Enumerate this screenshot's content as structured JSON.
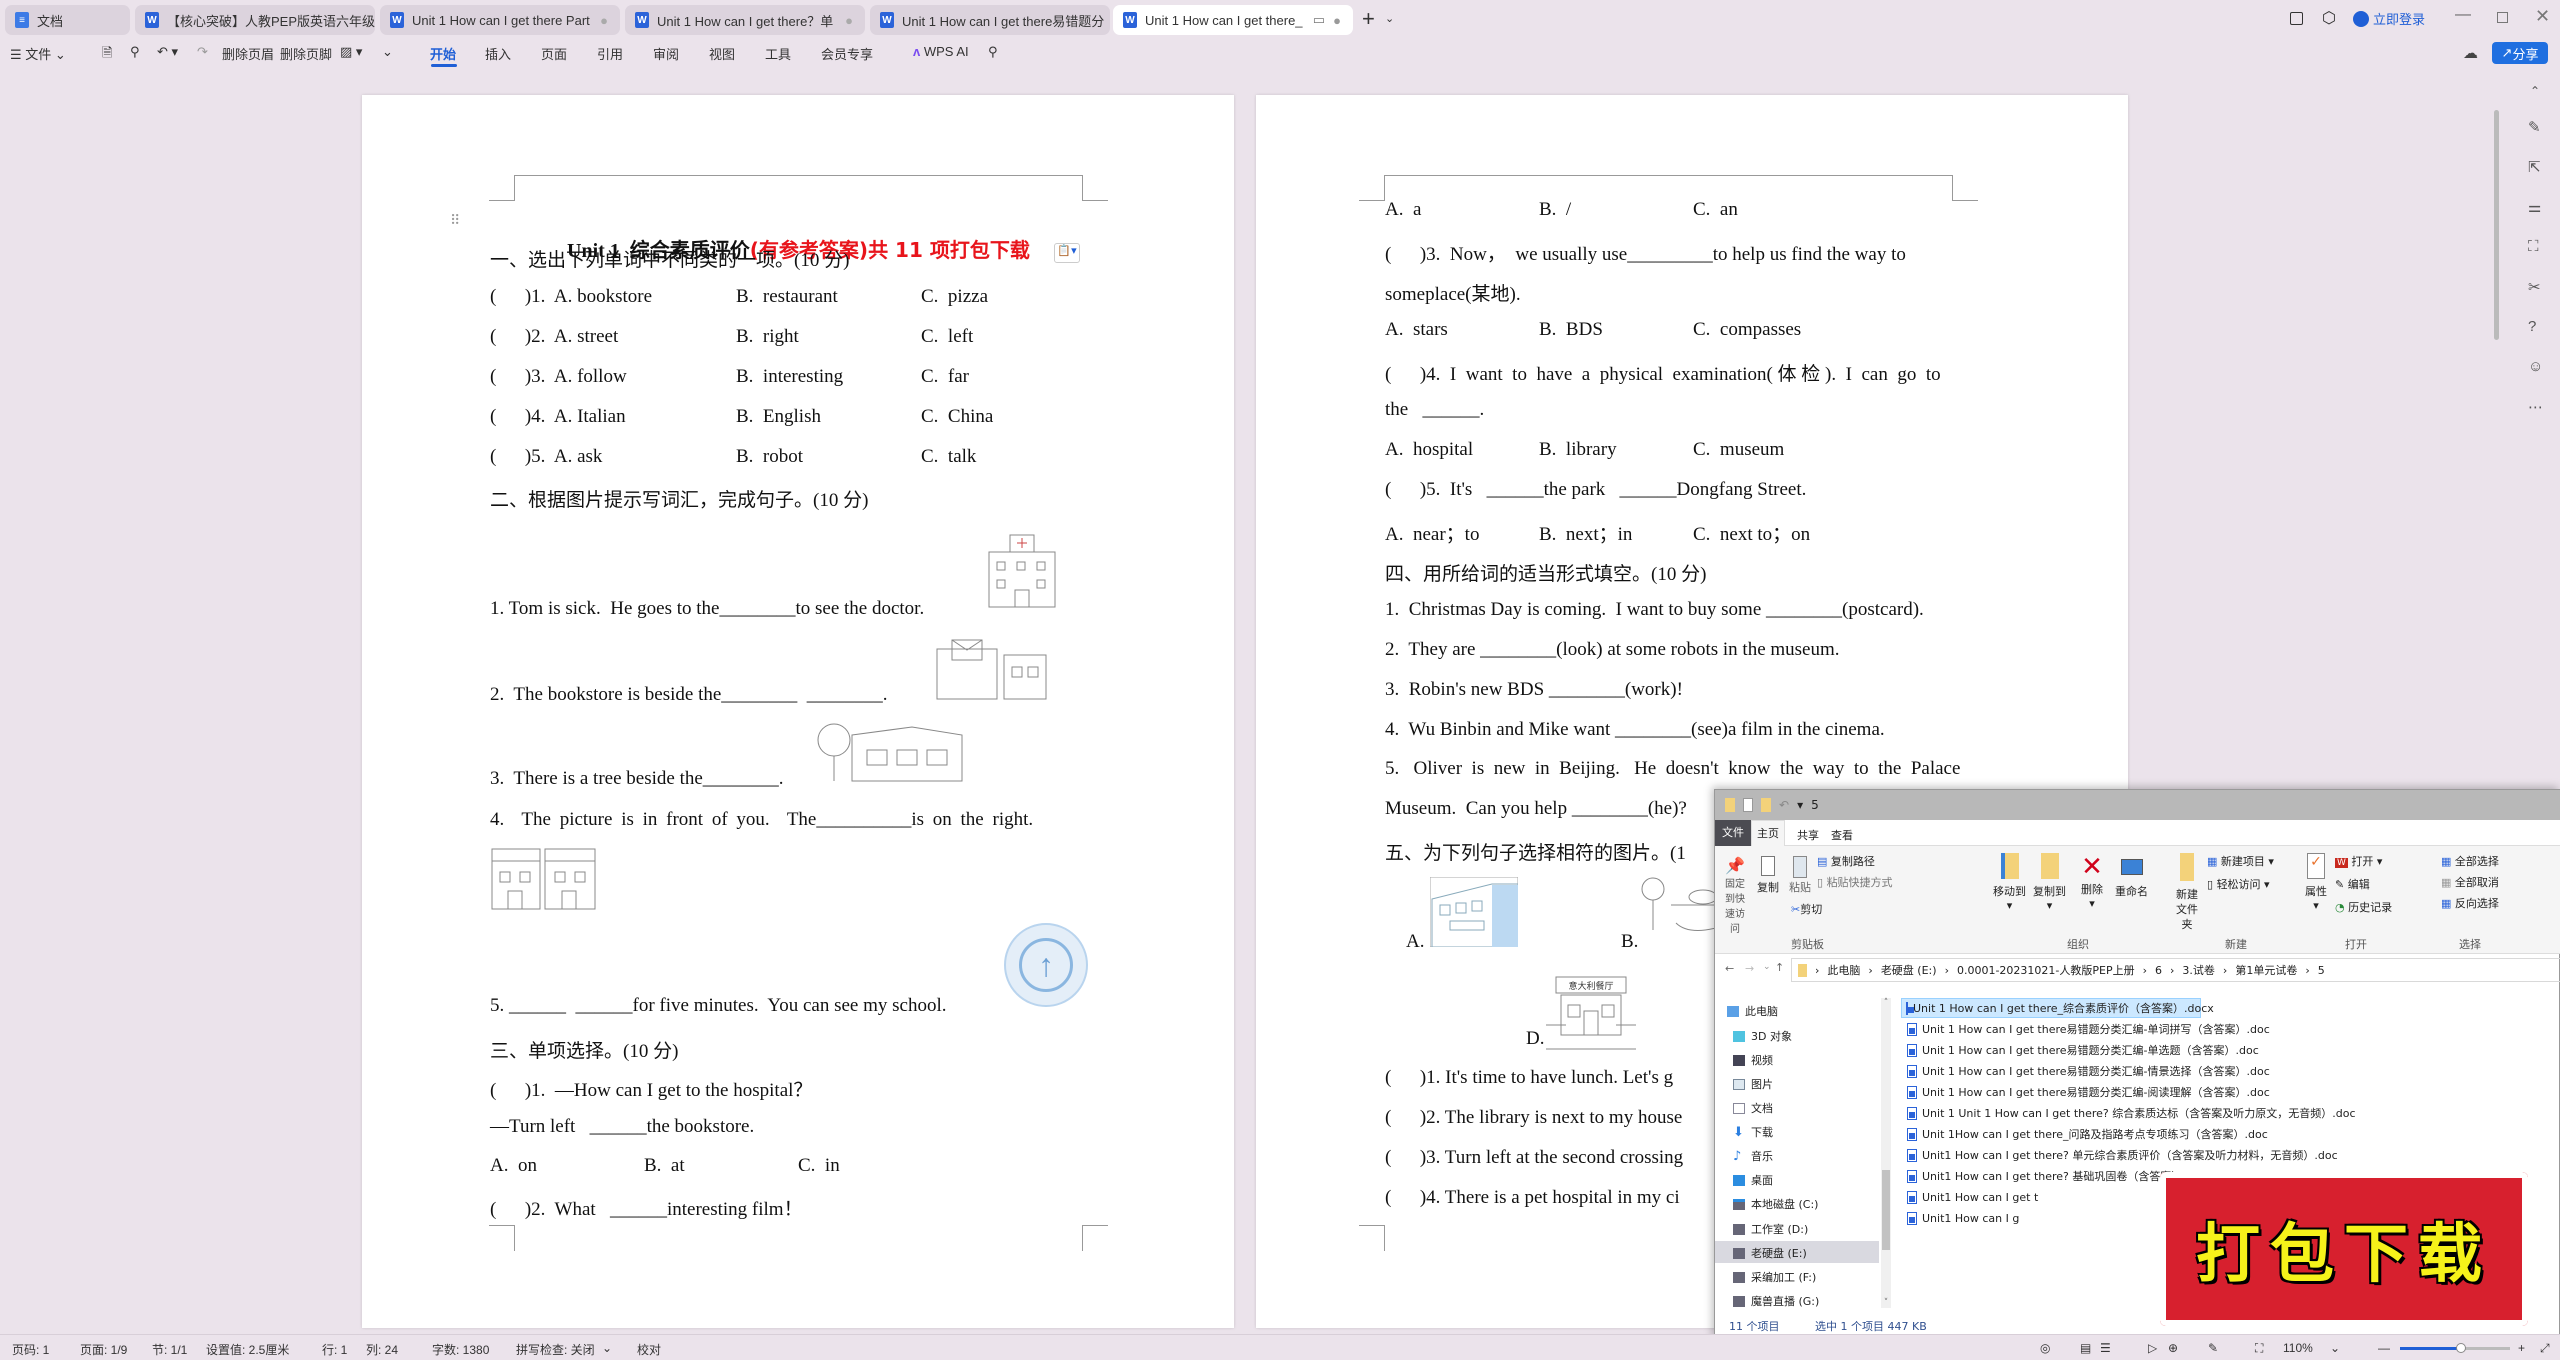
{
  "tabs": [
    {
      "label": "文档"
    },
    {
      "label": "【核心突破】人教PEP版英语六年级上"
    },
    {
      "label": "Unit 1 How can I get there Part"
    },
    {
      "label": "Unit 1 How can I get there？单"
    },
    {
      "label": "Unit 1 How can I get there易错题分"
    },
    {
      "label": "Unit 1 How can I get there_"
    }
  ],
  "titlebar": {
    "login": "立即登录",
    "share": "分享"
  },
  "toolbar": {
    "file": "文件",
    "delete_header": "删除页眉",
    "delete_footer": "删除页脚",
    "menus": [
      "开始",
      "插入",
      "页面",
      "引用",
      "审阅",
      "视图",
      "工具",
      "会员专享"
    ],
    "wps_ai": "WPS AI"
  },
  "left_page": {
    "title_black": "Unit 1  综合素质评价",
    "title_red": "(有参考答案)共 11 项打包下载",
    "section1": "一、选出下列单词中不同类的一项。(10 分)",
    "s1_rows": [
      {
        "q": "(      )1.  A. bookstore",
        "b": "B.  restaurant",
        "c": "C.  pizza"
      },
      {
        "q": "(      )2.  A. street",
        "b": "B.  right",
        "c": "C.  left"
      },
      {
        "q": "(      )3.  A. follow",
        "b": "B.  interesting",
        "c": "C.  far"
      },
      {
        "q": "(      )4.  A. Italian",
        "b": "B.  English",
        "c": "C.  China"
      },
      {
        "q": "(      )5.  A. ask",
        "b": "B.  robot",
        "c": "C.  talk"
      }
    ],
    "section2": "二、根据图片提示写词汇，完成句子。(10 分)",
    "s2": [
      "1. Tom is sick.  He goes to the________to see the doctor.",
      "2.  The bookstore is beside the________  ________.",
      "3.  There is a tree beside the________.",
      "4.  The picture is in front of you.  The__________is on the right.",
      "5. ______  ______for five minutes.  You can see my school."
    ],
    "section3": "三、单项选择。(10 分)",
    "s3": [
      "(      )1.  —How can I get to the hospital？",
      "—Turn left   ______the bookstore.",
      "(      )2.  What   ______interesting film！"
    ],
    "s3_options": {
      "a": "A.  on",
      "b": "B.  at",
      "c": "C.  in"
    }
  },
  "right_page": {
    "opts1": {
      "a": "A.  a",
      "b": "B.  /",
      "c": "C.  an"
    },
    "q3_l1": "(      )3.  Now，  we usually use_________to help us find the way to",
    "q3_l2": "someplace(某地).",
    "opts3": {
      "a": "A.  stars",
      "b": "B.  BDS",
      "c": "C.  compasses"
    },
    "q4_l1": "(      )4.  I  want  to  have  a  physical  examination( 体 检 ).  I  can  go  to",
    "q4_l2": "the   ______.",
    "opts4": {
      "a": "A.  hospital",
      "b": "B.  library",
      "c": "C.  museum"
    },
    "q5": "(      )5.  It's   ______the park   ______Dongfang Street.",
    "opts5": {
      "a": "A.  near；to",
      "b": "B.  next；in",
      "c": "C.  next to；on"
    },
    "section4": "四、用所给词的适当形式填空。(10 分)",
    "s4": [
      "1.  Christmas Day is coming.  I want to buy some ________(postcard).",
      "2.  They are ________(look) at some robots in the museum.",
      "3.  Robin's new BDS ________(work)!",
      "4.  Wu Binbin and Mike want ________(see)a film in the cinema.",
      "5.   Oliver  is  new  in  Beijing.   He  doesn't  know  the  way  to  the  Palace",
      "Museum.  Can you help ________(he)?"
    ],
    "section5": "五、为下列句子选择相符的图片。(1",
    "pic_labels": [
      "A.",
      "B.",
      "D."
    ],
    "pic_sign_d": "意大利餐厅",
    "s5": [
      "(      )1. It's time to have lunch. Let's g",
      "(      )2. The library is next to my house",
      "(      )3. Turn left at the second crossing",
      "(      )4. There is a pet hospital in my ci"
    ]
  },
  "explorer": {
    "title": "5",
    "ribbon_tabs": [
      "文件",
      "主页",
      "共享",
      "查看"
    ],
    "clipboard": {
      "pin": "固定到快速访问",
      "copy": "复制",
      "paste": "粘贴",
      "copy_path": "复制路径",
      "paste_shortcut": "粘贴快捷方式",
      "cut": "剪切",
      "label": "剪贴板"
    },
    "organize": {
      "move_to": "移动到",
      "copy_to": "复制到",
      "delete": "删除",
      "rename": "重命名",
      "label": "组织"
    },
    "new": {
      "new_folder": "新建文件夹",
      "new_item": "新建项目",
      "easy_access": "轻松访问",
      "label": "新建"
    },
    "open": {
      "properties": "属性",
      "open": "打开",
      "edit": "编辑",
      "history": "历史记录",
      "label": "打开"
    },
    "select": {
      "select_all": "全部选择",
      "select_none": "全部取消",
      "invert": "反向选择",
      "label": "选择"
    },
    "path": [
      "此电脑",
      "老硬盘 (E:)",
      "0.0001-20231021-人教版PEP上册",
      "6",
      "3.试卷",
      "第1单元试卷",
      "5"
    ],
    "nav": [
      "此电脑",
      "3D 对象",
      "视频",
      "图片",
      "文档",
      "下载",
      "音乐",
      "桌面",
      "本地磁盘 (C:)",
      "工作室 (D:)",
      "老硬盘 (E:)",
      "采编加工 (F:)",
      "魔兽直播 (G:)"
    ],
    "files": [
      "Unit 1 How can I get there_综合素质评价（含答案）.docx",
      "Unit 1 How can I get there易错题分类汇编-单词拼写（含答案）.doc",
      "Unit 1 How can I get there易错题分类汇编-单选题（含答案）.doc",
      "Unit 1 How can I get there易错题分类汇编-情景选择（含答案）.doc",
      "Unit 1 How can I get there易错题分类汇编-阅读理解（含答案）.doc",
      "Unit 1 Unit 1 How can I get there? 综合素质达标（含答案及听力原文，无音频）.doc",
      "Unit 1How can I get there_问路及指路考点专项练习（含答案）.doc",
      "Unit1 How can I get there?  单元综合素质评价（含答案及听力材料，无音频）.doc",
      "Unit1 How can I get there?  基础巩固卷（含答案）.docx",
      "Unit1 How can I get t",
      "Unit1 How can I g"
    ],
    "status": {
      "count": "11 个项目",
      "selected": "选中 1 个项目  447 KB"
    }
  },
  "stamp": {
    "text": "打包下载"
  },
  "statusbar": {
    "page_no": "页码: 1",
    "pages": "页面: 1/9",
    "section": "节: 1/1",
    "setting": "设置值: 2.5厘米",
    "row": "行: 1",
    "col": "列: 24",
    "words": "字数: 1380",
    "spell": "拼写检查: 关闭",
    "proof": "校对",
    "zoom": "110%",
    "zoom_level": 0.55
  },
  "colors": {
    "accent": "#1f5fd6",
    "title_red": "#e8141b",
    "stamp_red": "#d7202e",
    "stamp_text": "#f6f21a"
  }
}
